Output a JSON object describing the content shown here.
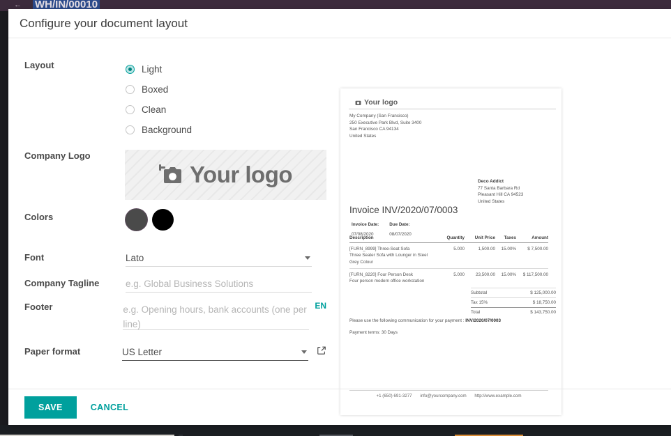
{
  "app": {
    "breadcrumb": "WH/IN/00010",
    "back_icon": "back-arrow-icon",
    "topbar_color": "#3c2b3c",
    "taskbar_color": "#1b1e22"
  },
  "dialog": {
    "title": "Configure your document layout",
    "save_label": "SAVE",
    "cancel_label": "CANCEL",
    "accent_color": "#00a09d"
  },
  "form": {
    "layout": {
      "label": "Layout",
      "selected": "Light",
      "options": [
        {
          "label": "Light",
          "selected": true
        },
        {
          "label": "Boxed",
          "selected": false
        },
        {
          "label": "Clean",
          "selected": false
        },
        {
          "label": "Background",
          "selected": false
        }
      ]
    },
    "company_logo": {
      "label": "Company Logo",
      "placeholder_text": "Your logo",
      "icon": "camera-add-icon"
    },
    "colors": {
      "label": "Colors",
      "swatches": [
        {
          "name": "primary-color-swatch",
          "hex": "#4a4a4a"
        },
        {
          "name": "secondary-color-swatch",
          "hex": "#000000"
        }
      ]
    },
    "font": {
      "label": "Font",
      "value": "Lato",
      "caret_icon": "chevron-down-icon"
    },
    "company_tagline": {
      "label": "Company Tagline",
      "value": "",
      "placeholder": "e.g. Global Business Solutions"
    },
    "footer": {
      "label": "Footer",
      "value": "",
      "placeholder": "e.g. Opening hours, bank accounts (one per line)",
      "translate_badge": "EN"
    },
    "paper_format": {
      "label": "Paper format",
      "value": "US Letter",
      "caret_icon": "chevron-down-icon",
      "external_link_icon": "external-link-icon"
    }
  },
  "preview": {
    "logo_text": "Your logo",
    "logo_icon": "image-icon",
    "company_address": [
      "My Company (San Francisco)",
      "250 Executive Park Blvd, Suite 3400",
      "San Francisco CA 94134",
      "United States"
    ],
    "customer_address": [
      "Deco Addict",
      "77 Santa Barbara Rd",
      "Pleasant Hill CA 94523",
      "United States"
    ],
    "invoice_title": "Invoice INV/2020/07/0003",
    "dates": {
      "invoice_date_label": "Invoice Date:",
      "invoice_date_value": "07/08/2020",
      "due_date_label": "Due Date:",
      "due_date_value": "08/07/2020"
    },
    "table": {
      "headers": [
        "Description",
        "Quantity",
        "Unit Price",
        "Taxes",
        "Amount"
      ],
      "rows": [
        {
          "description": "[FURN_8999] Three-Seat Sofa",
          "sub_description": "Three Seater Sofa with Lounger in Steel Grey Colour",
          "quantity": "5.000",
          "unit_price": "1,500.00",
          "taxes": "15.00%",
          "amount": "$ 7,500.00"
        },
        {
          "description": "[FURN_8220] Four Person Desk",
          "sub_description": "Four person modern office workstation",
          "quantity": "5.000",
          "unit_price": "23,500.00",
          "taxes": "15.00%",
          "amount": "$ 117,500.00"
        }
      ]
    },
    "totals": [
      {
        "label": "Subtotal",
        "value": "$ 125,000.00"
      },
      {
        "label": "Tax 15%",
        "value": "$ 18,750.00"
      },
      {
        "label": "Total",
        "value": "$ 143,750.00"
      }
    ],
    "payment_communication_prefix": "Please use the following communication for your payment : ",
    "payment_communication_ref": "INV/2020/07/0003",
    "payment_terms": "Payment terms: 30 Days",
    "footer_phone": "+1 (650) 691-3277",
    "footer_email": "info@yourcompany.com",
    "footer_website": "http://www.example.com"
  }
}
